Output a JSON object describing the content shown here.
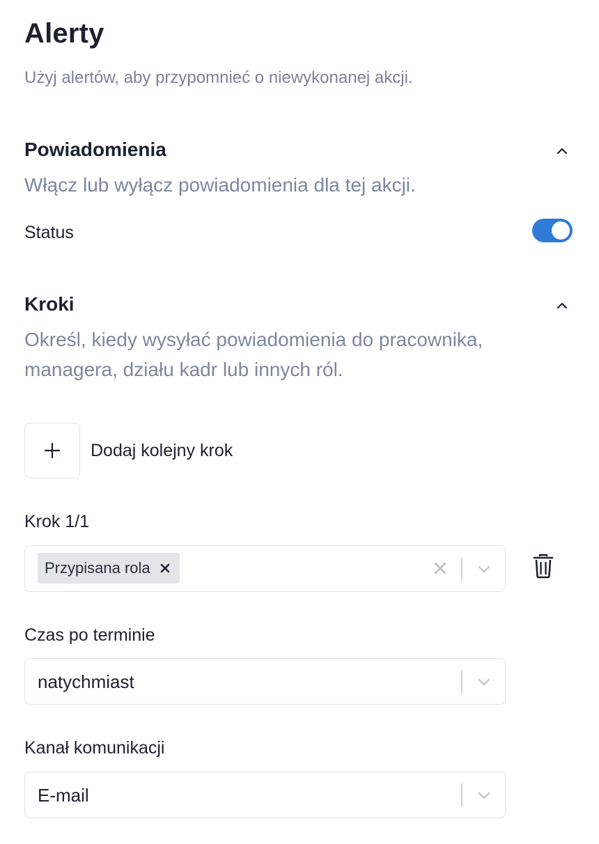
{
  "header": {
    "title": "Alerty",
    "subtitle": "Użyj alertów, aby przypomnieć o niewykonanej akcji."
  },
  "notifications": {
    "title": "Powiadomienia",
    "description": "Włącz lub wyłącz powiadomienia dla tej akcji.",
    "status_label": "Status",
    "status_enabled": true
  },
  "steps": {
    "title": "Kroki",
    "description": "Określ, kiedy wysyłać powiadomienia do pracownika, managera, działu kadr lub innych ról.",
    "add_step_label": "Dodaj kolejny krok",
    "step_label": "Krok 1/1",
    "recipients": {
      "selected_tags": [
        "Przypisana rola"
      ]
    },
    "delay": {
      "label": "Czas po terminie",
      "value": "natychmiast"
    },
    "channel": {
      "label": "Kanał komunikacji",
      "value": "E-mail"
    }
  },
  "colors": {
    "accent": "#2f7bd6",
    "muted_text": "#7d879c",
    "border": "#dfe2e8",
    "tag_bg": "#e3e5e8"
  },
  "icons": {
    "collapse": "chevron-up-icon",
    "dropdown": "chevron-down-icon",
    "add": "plus-icon",
    "clear": "close-icon",
    "delete": "trash-icon"
  }
}
